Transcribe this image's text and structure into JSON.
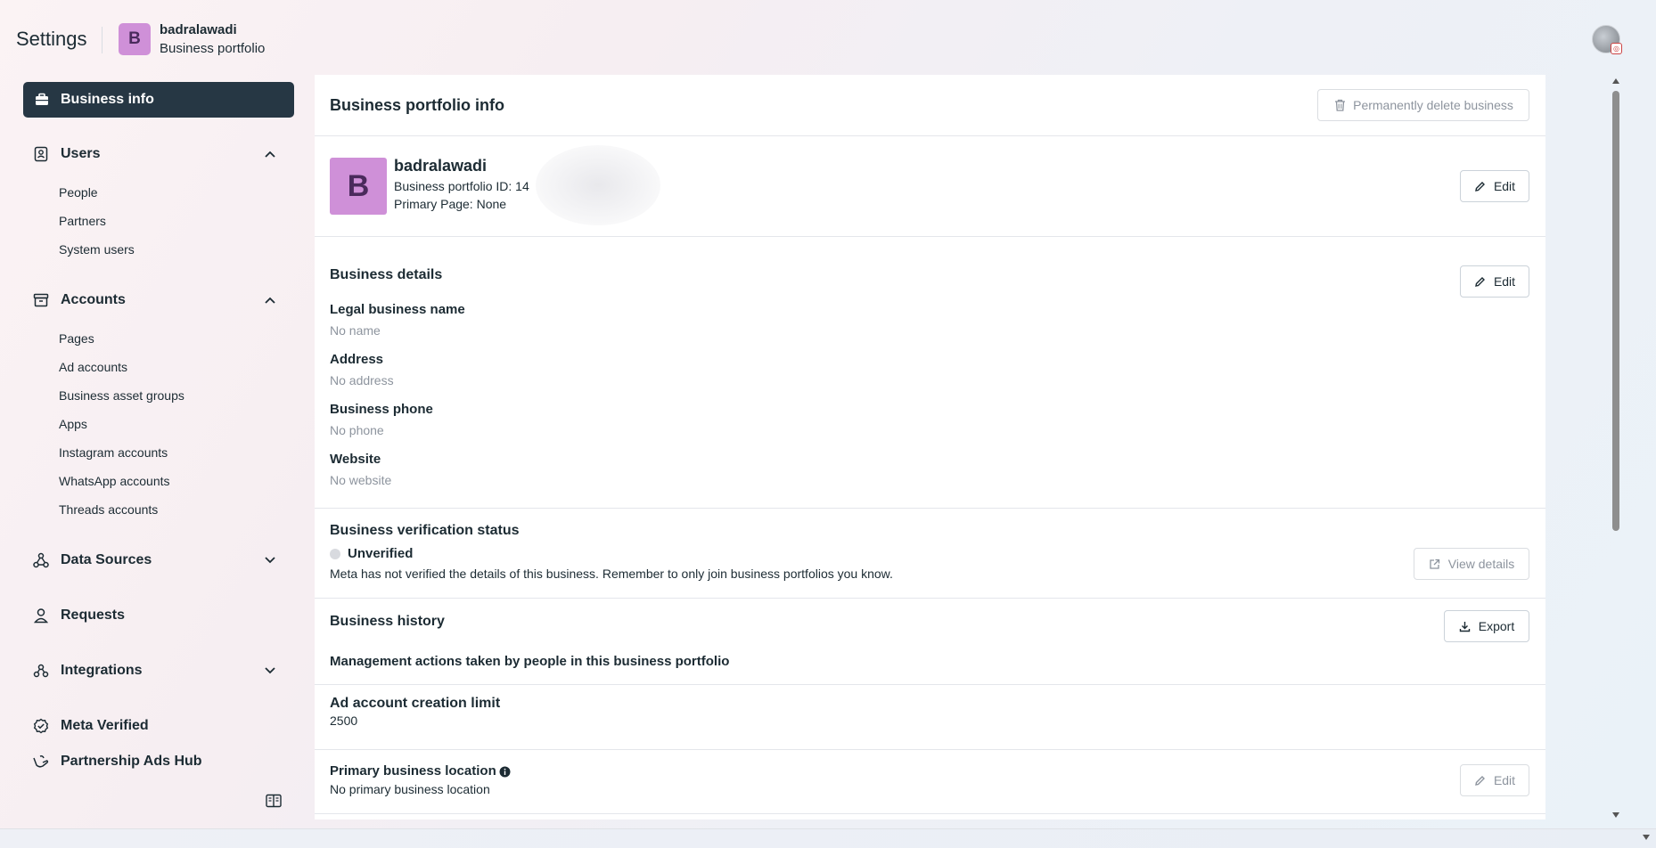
{
  "header": {
    "title": "Settings",
    "portfolio_initial": "B",
    "portfolio_name": "badralawadi",
    "portfolio_type": "Business portfolio"
  },
  "sidebar": {
    "business_info": "Business info",
    "users": {
      "label": "Users",
      "items": [
        "People",
        "Partners",
        "System users"
      ]
    },
    "accounts": {
      "label": "Accounts",
      "items": [
        "Pages",
        "Ad accounts",
        "Business asset groups",
        "Apps",
        "Instagram accounts",
        "WhatsApp accounts",
        "Threads accounts"
      ]
    },
    "data_sources": "Data Sources",
    "requests": "Requests",
    "integrations": "Integrations",
    "meta_verified": "Meta Verified",
    "partnership_ads_hub": "Partnership Ads Hub"
  },
  "main": {
    "title": "Business portfolio info",
    "delete_button": "Permanently delete business",
    "profile": {
      "initial": "B",
      "name": "badralawadi",
      "id_text": "Business portfolio ID: 14",
      "primary_page": "Primary Page: None",
      "edit": "Edit"
    },
    "details": {
      "title": "Business details",
      "edit": "Edit",
      "legal_label": "Legal business name",
      "legal_value": "No name",
      "address_label": "Address",
      "address_value": "No address",
      "phone_label": "Business phone",
      "phone_value": "No phone",
      "website_label": "Website",
      "website_value": "No website"
    },
    "verification": {
      "title": "Business verification status",
      "status": "Unverified",
      "description": "Meta has not verified the details of this business. Remember to only join business portfolios you know.",
      "button": "View details"
    },
    "history": {
      "title": "Business history",
      "subtitle": "Management actions taken by people in this business portfolio",
      "button": "Export"
    },
    "ad_limit": {
      "title": "Ad account creation limit",
      "value": "2500"
    },
    "location": {
      "title": "Primary business location",
      "value": "No primary business location",
      "button": "Edit"
    }
  }
}
